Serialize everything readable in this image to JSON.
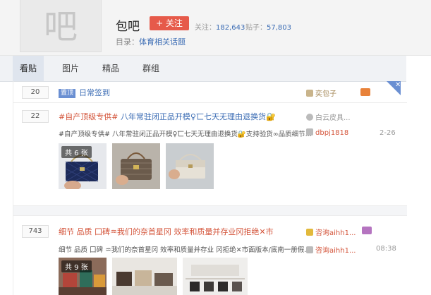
{
  "forum": {
    "avatar_char": "吧",
    "name": "包吧",
    "follow_label": "+ 关注",
    "followers_label": "关注：",
    "followers_value": "182,643",
    "posts_label": "贴子：",
    "posts_value": "57,803",
    "catalog_label": "目录：",
    "catalog_value": "体育相关话题"
  },
  "tabs": [
    "看贴",
    "图片",
    "精品",
    "群组"
  ],
  "threads": [
    {
      "reply_count": "20",
      "badge": "置顶",
      "title": "日常签到",
      "author": "奕包子"
    },
    {
      "reply_count": "22",
      "tag": "#自产顶级专供#",
      "title": "八年常驻闭正品开模♀匸七天无理由退换货🔐",
      "abstract": "#自产顶级专供# 八年常驻闭正品开模♀匸七天无理由退换货🔐支持验货∞品质细节...",
      "author": "白云皮具...",
      "last_reply_user": "dbpj1818",
      "last_reply_time": "2-26",
      "image_count_label": "共 6 张"
    },
    {
      "reply_count": "743",
      "title": "细节 品质 囗碑♒我们的奈首星冈 效率和质量并存业冈拒绝✕市",
      "abstract": "细节 品质 囗碑 ♒我们的奈首星冈 效率和质量并存业 冈拒绝✕市面版本/底南一册假...",
      "author": "咨询aihh1...",
      "last_reply_user": "咨询aihh1...",
      "last_reply_time": "08:38",
      "image_count_label": "共 9 张"
    }
  ]
}
